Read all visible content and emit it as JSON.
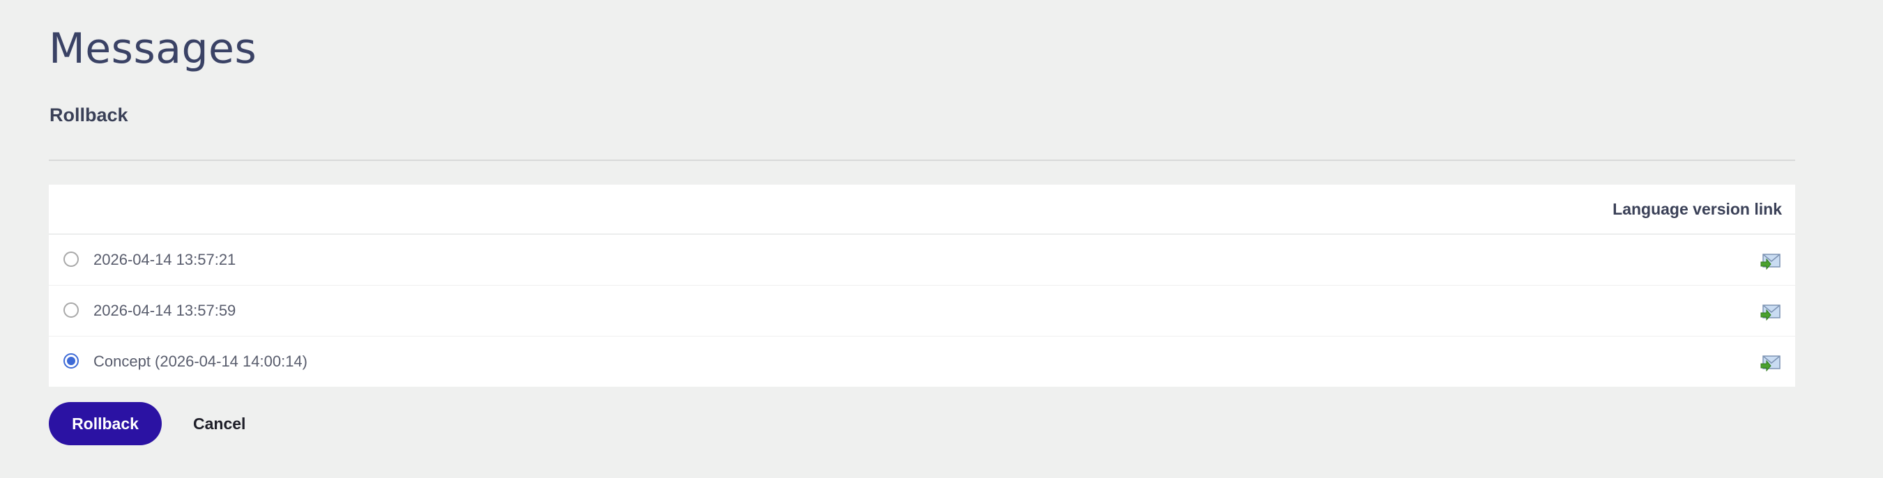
{
  "page": {
    "title": "Messages",
    "section_title": "Rollback"
  },
  "table": {
    "column_header": "Language version link",
    "rows": [
      {
        "label": "2026-04-14 13:57:21",
        "selected": false,
        "icon": "language-version-link-icon"
      },
      {
        "label": "2026-04-14 13:57:59",
        "selected": false,
        "icon": "language-version-link-icon"
      },
      {
        "label": "Concept (2026-04-14 14:00:14)",
        "selected": true,
        "icon": "language-version-link-icon"
      }
    ]
  },
  "actions": {
    "rollback_label": "Rollback",
    "cancel_label": "Cancel"
  },
  "colors": {
    "background": "#eff0ef",
    "primary_button": "#2b12a3",
    "radio_selected": "#3d6ad6",
    "title_text": "#3a4265"
  }
}
